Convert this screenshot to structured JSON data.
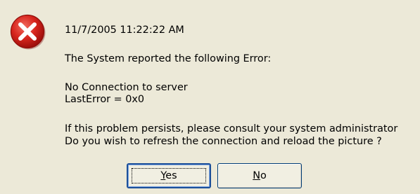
{
  "dialog": {
    "icon": "error-icon",
    "timestamp": "11/7/2005 11:22:22 AM",
    "intro": "The System reported the following Error:",
    "error_line1": "No Connection to server",
    "error_line2": "LastError = 0x0",
    "advice_line1": "If this problem persists, please consult your system administrator",
    "question_line": "Do you wish to refresh the connection and reload the picture ?"
  },
  "buttons": {
    "yes_accel": "Y",
    "yes_rest": "es",
    "no_accel": "N",
    "no_rest": "o"
  },
  "colors": {
    "dialog_bg": "#ECE9D8",
    "icon_red": "#D7261E",
    "button_border": "#003C74"
  }
}
